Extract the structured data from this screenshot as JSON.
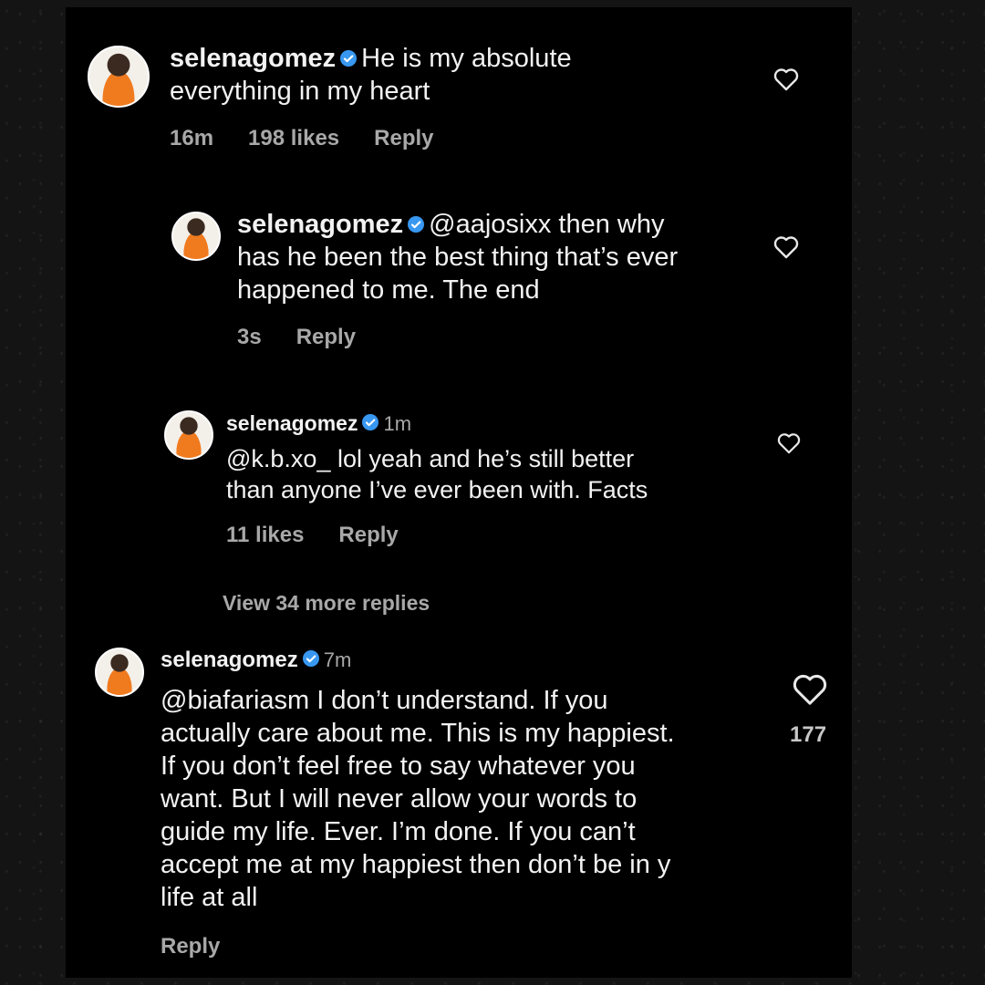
{
  "comments": [
    {
      "username": "selenagomez",
      "text_lines": [
        "He is my absolute",
        "everything in my heart"
      ],
      "meta": [
        "16m",
        "198 likes",
        "Reply"
      ]
    },
    {
      "username": "selenagomez",
      "mention": "@aajosixx",
      "text_lines": [
        " then why",
        "has he been the best thing that’s ever",
        "happened to me. The end"
      ],
      "meta": [
        "3s",
        "Reply"
      ]
    },
    {
      "username": "selenagomez",
      "time": "1m",
      "text_lines": [
        "@k.b.xo_ lol yeah and he’s still better",
        "than anyone I’ve ever been with. Facts"
      ],
      "meta": [
        "11 likes",
        "Reply"
      ]
    },
    {
      "username": "selenagomez",
      "time": "7m",
      "text_lines": [
        "@biafariasm I don’t understand. If you",
        "actually care about me. This is my happiest.",
        "If you don’t feel free to say whatever you",
        "want. But I will never allow your words to",
        "guide my life. Ever. I’m done. If you can’t",
        "accept me at my happiest then don’t be in y",
        "life at all"
      ],
      "meta": [
        "Reply"
      ],
      "like_count": "177"
    }
  ],
  "view_more": "View 34 more replies",
  "icons": {
    "verified": "verified-badge-icon",
    "like": "heart-outline-icon"
  },
  "colors": {
    "verified": "#3897f0",
    "background": "#000000",
    "muted": "#a8a8a8"
  }
}
